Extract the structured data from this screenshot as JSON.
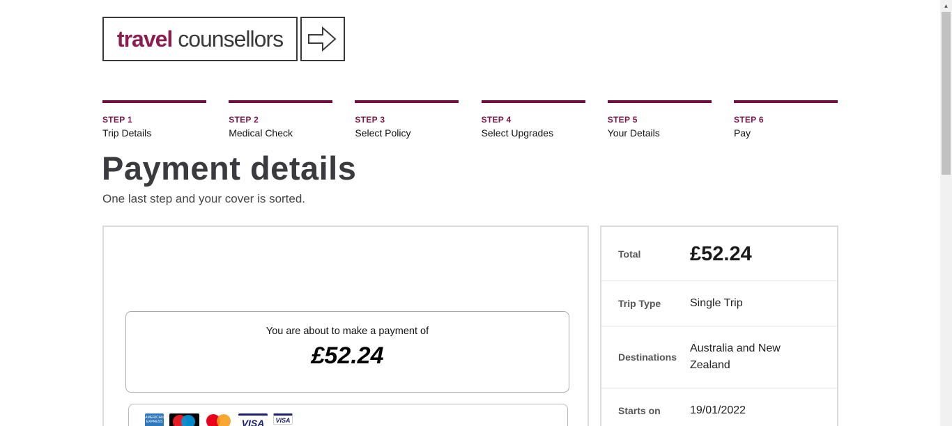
{
  "logo": {
    "word1": "travel",
    "word2": "counsellors",
    "arrow_icon": "arrow-right-icon"
  },
  "steps": [
    {
      "num": "STEP 1",
      "label": "Trip Details"
    },
    {
      "num": "STEP 2",
      "label": "Medical Check"
    },
    {
      "num": "STEP 3",
      "label": "Select Policy"
    },
    {
      "num": "STEP 4",
      "label": "Select Upgrades"
    },
    {
      "num": "STEP 5",
      "label": "Your Details"
    },
    {
      "num": "STEP 6",
      "label": "Pay"
    }
  ],
  "page": {
    "title": "Payment details",
    "subtitle": "One last step and your cover is sorted."
  },
  "payment": {
    "intro": "You are about to make a payment of",
    "amount": "£52.24",
    "cards": [
      "amex-icon",
      "maestro-icon",
      "mastercard-icon",
      "visa-icon",
      "visa-electron-icon"
    ],
    "visa_text": "VISA"
  },
  "summary": {
    "total_label": "Total",
    "total_value": "£52.24",
    "trip_type_label": "Trip Type",
    "trip_type_value": "Single Trip",
    "destinations_label": "Destinations",
    "destinations_value": "Australia and New Zealand",
    "starts_on_label": "Starts on",
    "starts_on_value": "19/01/2022"
  },
  "colors": {
    "brand": "#8c1d51",
    "step_bar": "#6e0f3f",
    "title": "#3b3b3f"
  }
}
